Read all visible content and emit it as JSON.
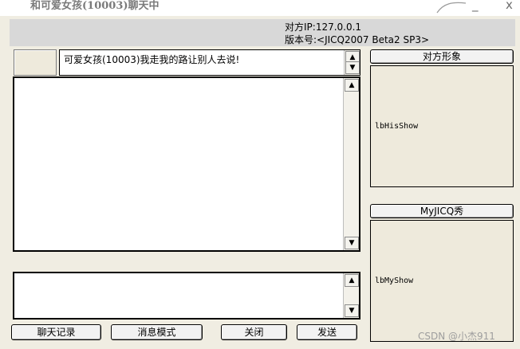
{
  "window": {
    "title": "和可爱女孩(10003)聊天中",
    "minimize": "_",
    "close": "x"
  },
  "info": {
    "ip_line": "对方IP:127.0.0.1",
    "version_line": "版本号:<JICQ2007 Beta2 SP3>"
  },
  "signature": {
    "text": "可爱女孩(10003)我走我的路让别人去说!"
  },
  "scroll": {
    "up": "▲",
    "down": "▼"
  },
  "side": {
    "his_image_button": "对方形象",
    "his_show_label": "lbHisShow",
    "my_show_button": "MyJICQ秀",
    "my_show_label": "lbMyShow"
  },
  "buttons": {
    "history": "聊天记录",
    "mode": "消息模式",
    "close": "关闭",
    "send": "发送"
  },
  "watermark": "CSDN @小杰911"
}
